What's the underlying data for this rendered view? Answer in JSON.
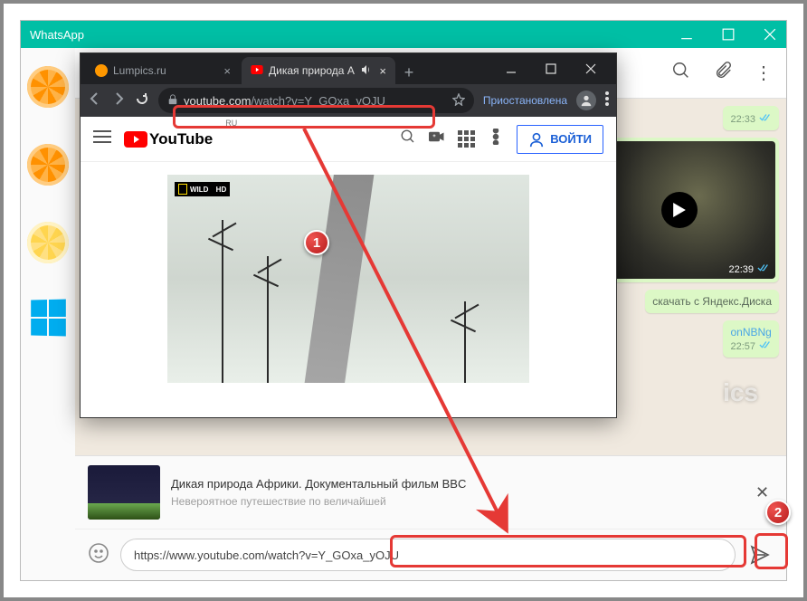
{
  "whatsapp": {
    "title": "WhatsApp",
    "messages": {
      "m1_time": "22:33",
      "video_duration": "22:39",
      "dl_text": "скачать с Яндекс.Диска",
      "link_text": "onNBNg",
      "link_time": "22:57"
    },
    "preview": {
      "title": "Дикая природа Африки. Документальный фильм BBC",
      "subtitle": "Невероятное путешествие по величайшей"
    },
    "compose": {
      "value": "https://www.youtube.com/watch?v=Y_GOxa_yOJU"
    }
  },
  "chrome": {
    "tab1": "Lumpics.ru",
    "tab2": "Дикая природа А",
    "url_host": "youtube.com",
    "url_path": "/watch?v=Y_GOxa_yOJU",
    "paused": "Приостановлена",
    "yt_text": "YouTube",
    "yt_ru": "RU",
    "login": "ВОЙТИ",
    "natgeo": "WILD",
    "natgeo_hd": "HD"
  },
  "watermark": "ics",
  "annotations": {
    "step1": "1",
    "step2": "2"
  }
}
